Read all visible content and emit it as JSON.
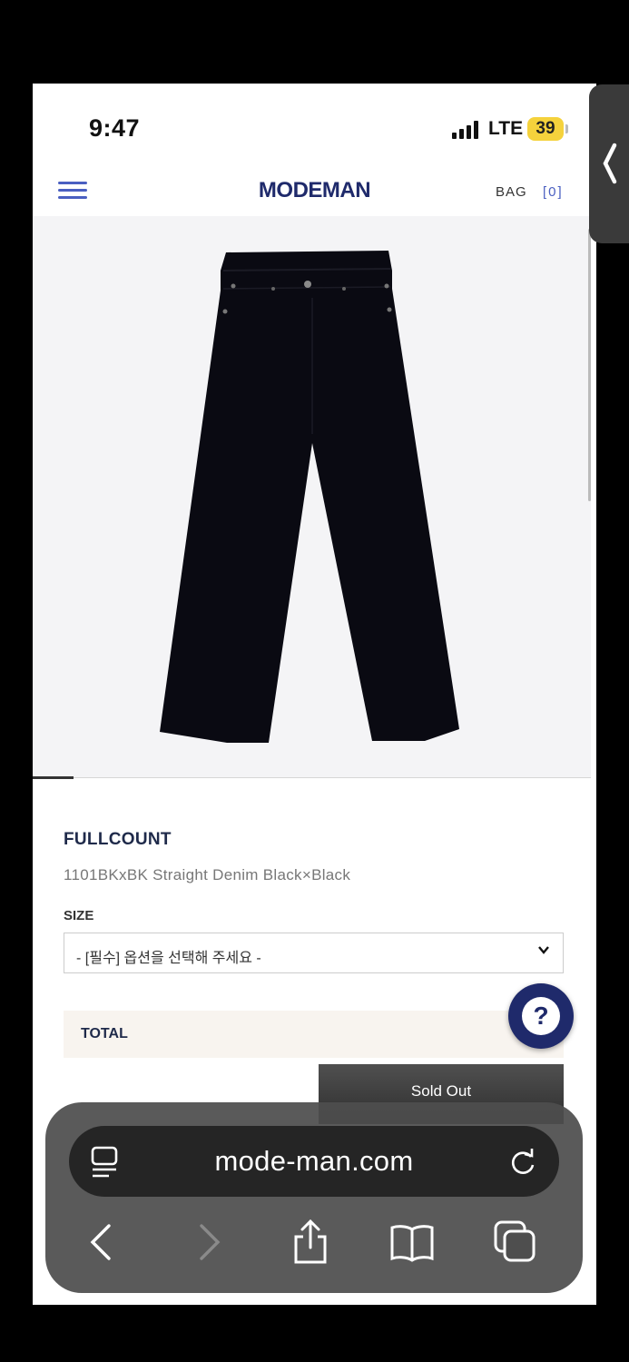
{
  "status_bar": {
    "time": "9:47",
    "network": "LTE",
    "battery": "39"
  },
  "header": {
    "logo": "MODEMAN",
    "bag_label": "BAG",
    "bag_count": "[0]",
    "accent_color": "#4a5fc1",
    "brand_color": "#1f2a6b"
  },
  "product": {
    "brand": "FULLCOUNT",
    "name": "1101BKxBK Straight Denim Black×Black",
    "image_icon": "black-straight-jeans",
    "size_label": "SIZE",
    "size_select_value": "- [필수] 옵션을 선택해 주세요 -",
    "total_label": "TOTAL",
    "sold_out_label": "Sold Out"
  },
  "help_button": {
    "label": "?"
  },
  "browser": {
    "url": "mode-man.com",
    "icons": [
      "reader-icon",
      "reload-icon",
      "back-icon",
      "forward-icon",
      "share-icon",
      "bookmarks-icon",
      "tabs-icon"
    ]
  }
}
